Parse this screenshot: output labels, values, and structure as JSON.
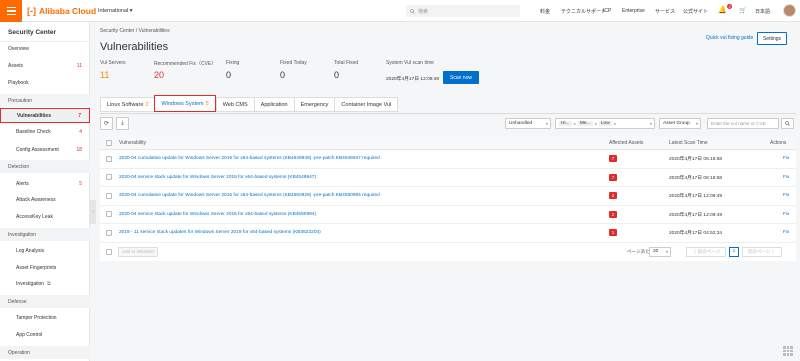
{
  "topbar": {
    "brand": "Alibaba Cloud",
    "region": "International ▾",
    "search_placeholder": "検索",
    "nav": [
      "料金",
      "テクニカルサポート",
      "ICP",
      "Enterprise",
      "サービス",
      "公式サイト"
    ],
    "notification_count": "2",
    "language": "日本語"
  },
  "sidebar": {
    "title": "Security Center",
    "items": [
      {
        "label": "Overview",
        "count": ""
      },
      {
        "label": "Assets",
        "count": "11"
      },
      {
        "label": "Playbook",
        "count": ""
      }
    ],
    "sections": [
      {
        "label": "Precaution",
        "items": [
          {
            "label": "Vulnerabilities",
            "count": "7",
            "active": true
          },
          {
            "label": "Baseline Check",
            "count": "4"
          },
          {
            "label": "Config Assessment",
            "count": "18"
          }
        ]
      },
      {
        "label": "Detection",
        "items": [
          {
            "label": "Alerts",
            "count": "5"
          },
          {
            "label": "Attack Awareness",
            "count": ""
          },
          {
            "label": "AccessKey Leak",
            "count": ""
          }
        ]
      },
      {
        "label": "Investigation",
        "items": [
          {
            "label": "Log Analysis",
            "count": ""
          },
          {
            "label": "Asset Fingerprints",
            "count": ""
          },
          {
            "label": "Investigation",
            "count": ""
          }
        ]
      },
      {
        "label": "Defense",
        "items": [
          {
            "label": "Tamper Protection",
            "count": ""
          },
          {
            "label": "App Control",
            "count": ""
          }
        ]
      },
      {
        "label": "Operation",
        "items": []
      }
    ]
  },
  "main": {
    "breadcrumb": "Security Center  /  Vulnerabilities",
    "title": "Vulnerabilities",
    "guide_link": "Quick vul fixing guide",
    "settings_label": "Settings",
    "stats": [
      {
        "label": "Vul Servers",
        "value": "11",
        "color": "#ff8a00"
      },
      {
        "label": "Recommended Fix（CVE）",
        "value": "20",
        "color": "#e22c2c"
      },
      {
        "label": "Fixing",
        "value": "0",
        "color": "#333333"
      },
      {
        "label": "Fixed Today",
        "value": "0",
        "color": "#333333"
      },
      {
        "label": "Total Fixed",
        "value": "0",
        "color": "#333333"
      }
    ],
    "scan_label": "System Vul scan time",
    "scan_time": "2020年4月17日 12:09:48",
    "scan_button": "Scan now",
    "tabs": [
      {
        "label": "Linux Software",
        "count": "2"
      },
      {
        "label": "Windows System",
        "count": "5",
        "active": true
      },
      {
        "label": "Web CMS",
        "count": ""
      },
      {
        "label": "Application",
        "count": ""
      },
      {
        "label": "Emergency",
        "count": ""
      },
      {
        "label": "Container Image Vul",
        "count": ""
      }
    ],
    "filters": {
      "status": "Unhandled",
      "priority_tags": [
        "Hi...",
        "Me...",
        "Low"
      ],
      "asset_group": "Asset Group",
      "search_placeholder": "Enter the vul name or CVE"
    },
    "table": {
      "headers": [
        "Vulnerability",
        "Affected Assets",
        "Latest Scan Time",
        "Actions"
      ],
      "rows": [
        {
          "name": "2020-04 cumulative update for Windows Server 2019 for x64-based systems (KB4549949) -pre-patch KB4549947 required",
          "assets": "7",
          "time": "2020年4月17日 06:16:58",
          "action": "Fix"
        },
        {
          "name": "2020-04 service stack update for Windows Server 2019 for x64-based systems (KB4549947)",
          "assets": "7",
          "time": "2020年4月17日 06:16:58",
          "action": "Fix"
        },
        {
          "name": "2020-04 cumulative update for Windows Server 2016 for x64-based systems (KB4550929) -pre-patch KB4550994 required",
          "assets": "2",
          "time": "2020年4月17日 12:09:49",
          "action": "Fix"
        },
        {
          "name": "2020-04 service stack update for Windows Server 2016 for x64-based systems (KB4550994)",
          "assets": "2",
          "time": "2020年4月17日 12:09:49",
          "action": "Fix"
        },
        {
          "name": "2019 - 11 service stack updates for Windows Server 2019 for x64-based systems (KB4523204)",
          "assets": "1",
          "time": "2020年4月17日 04:52:34",
          "action": "Fix"
        }
      ],
      "add_whitelist": "Add to Whitelist",
      "pager_label": "ページあたりの表示",
      "page_size": "20",
      "prev": "〈 前のページ",
      "page": "1",
      "next": "次のページ 〉"
    }
  }
}
